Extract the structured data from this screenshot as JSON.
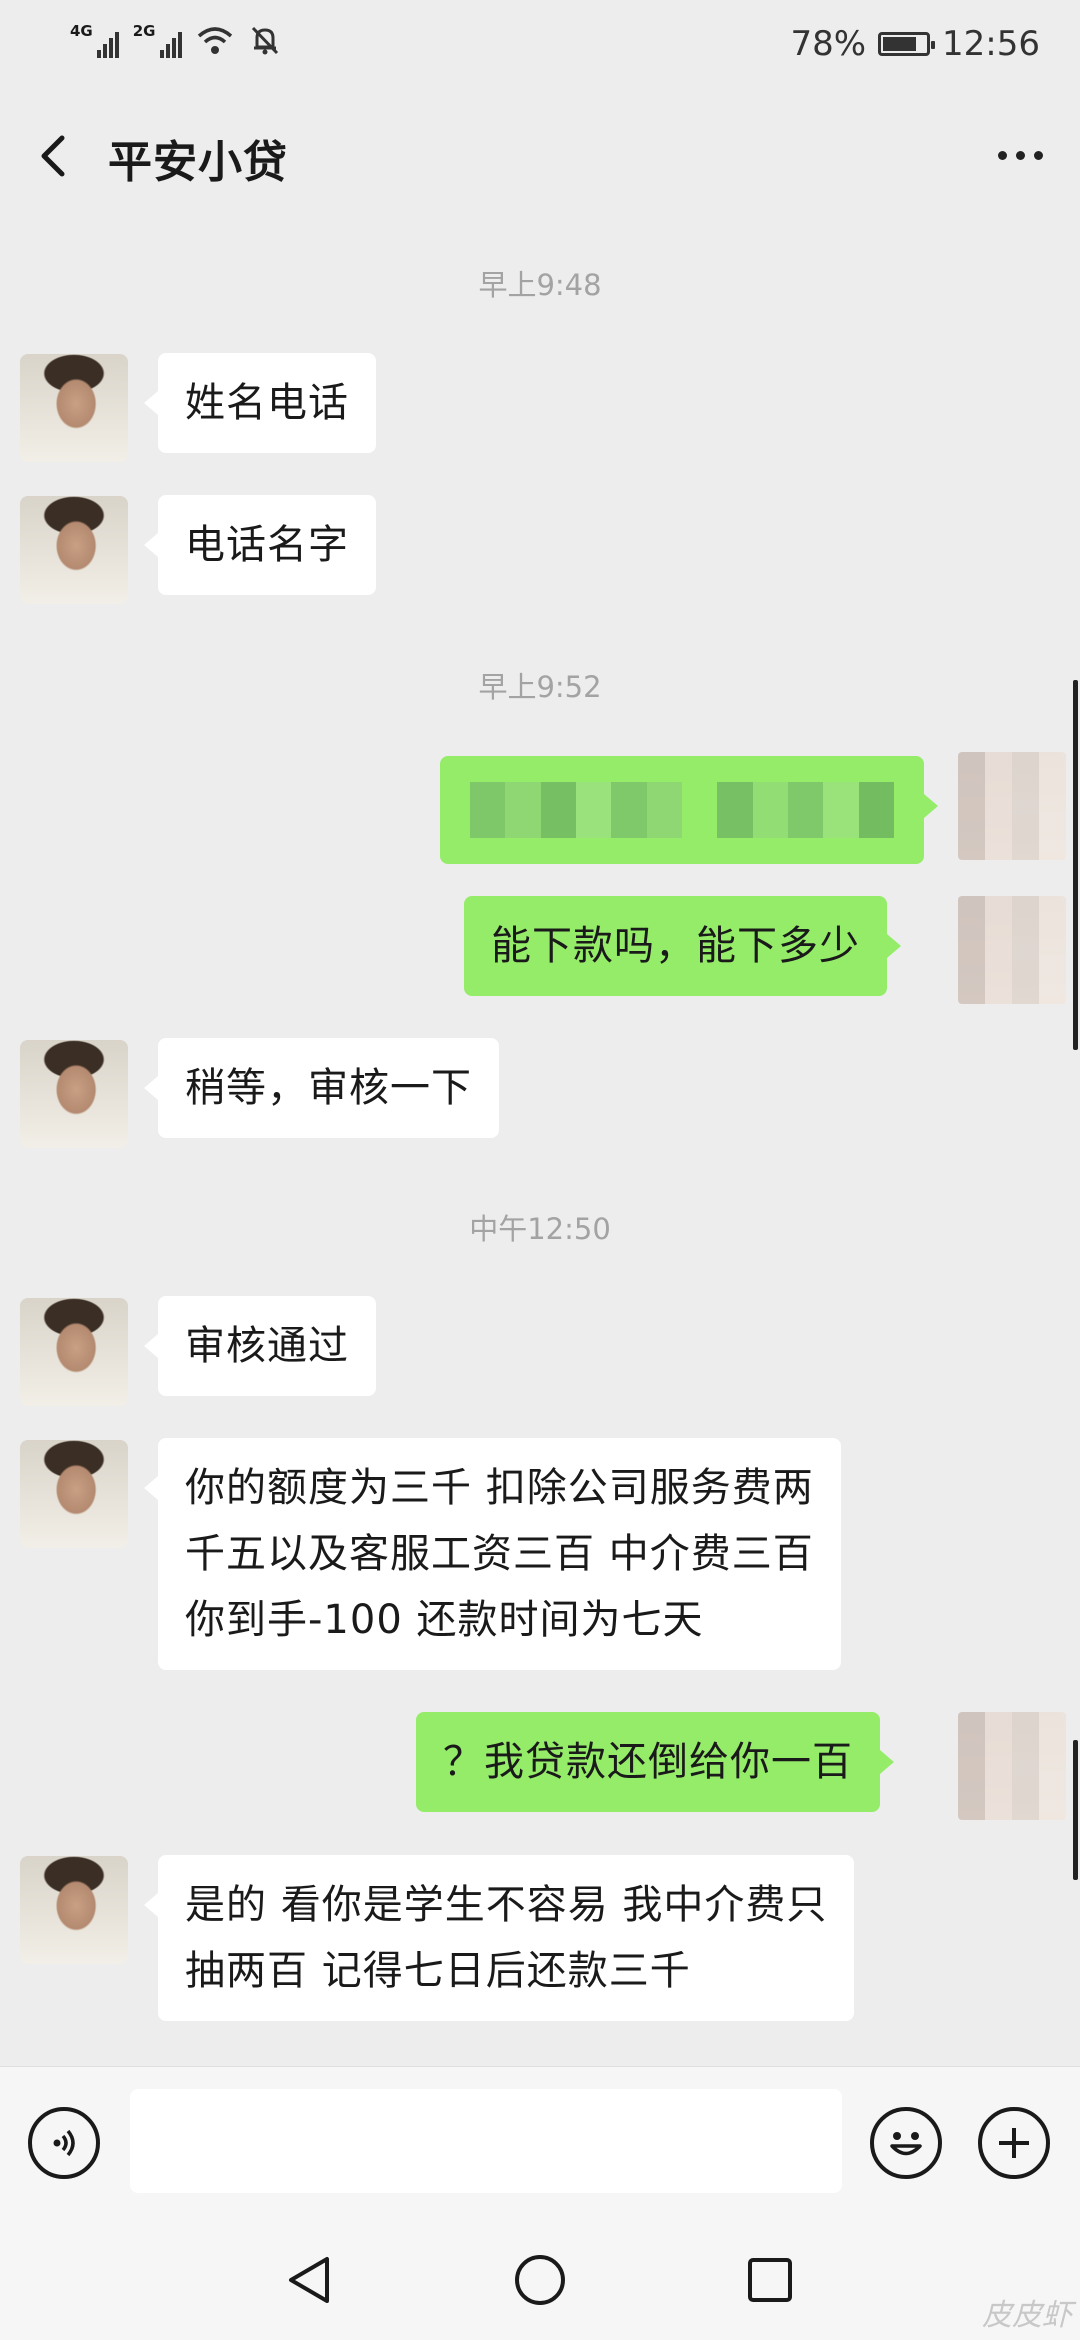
{
  "status_bar": {
    "signal1_label": "4G",
    "signal2_label": "2G",
    "battery_percent": "78%",
    "battery_level": 0.78,
    "time": "12:56"
  },
  "header": {
    "title": "平安小贷"
  },
  "timestamps": [
    "早上9:48",
    "早上9:52",
    "中午12:50"
  ],
  "messages": [
    {
      "side": "left",
      "text": "姓名电话"
    },
    {
      "side": "left",
      "text": "电话名字"
    },
    {
      "side": "right",
      "text": "",
      "redacted": true
    },
    {
      "side": "right",
      "text": "能下款吗，能下多少"
    },
    {
      "side": "left",
      "text": "稍等，审核一下"
    },
    {
      "side": "left",
      "text": "审核通过"
    },
    {
      "side": "left",
      "text": "你的额度为三千 扣除公司服务费两\n千五以及客服工资三百 中介费三百\n你到手-100 还款时间为七天"
    },
    {
      "side": "right",
      "text": "？我贷款还倒给你一百"
    },
    {
      "side": "left",
      "text": "是的 看你是学生不容易 我中介费只\n抽两百 记得七日后还款三千"
    }
  ],
  "input_bar": {
    "voice_icon": "voice-icon",
    "emoji_icon": "emoji-icon",
    "add_icon": "plus-icon"
  },
  "nav_bar": {
    "back_icon": "triangle-back-icon",
    "home_icon": "circle-home-icon",
    "recent_icon": "square-recent-icon"
  },
  "watermark": "皮皮虾",
  "colors": {
    "background": "#ededed",
    "bubble_self": "#95ec69",
    "bubble_other": "#ffffff",
    "timestamp": "#a3a3a3"
  }
}
